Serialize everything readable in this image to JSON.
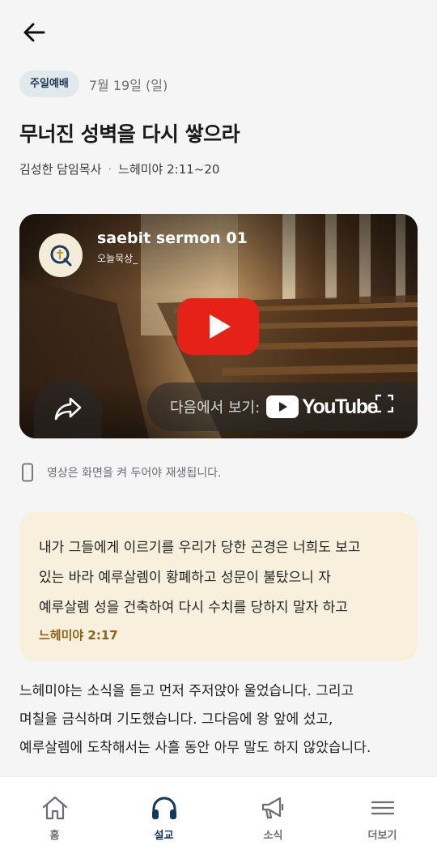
{
  "header": {
    "back_icon": "arrow-left-icon"
  },
  "sermon": {
    "category": "주일예배",
    "date": "7월 19일 (일)",
    "title": "무너진 성벽을 다시 쌓으라",
    "preacher": "김성한 담임목사",
    "separator": "·",
    "passage": "느헤미야 2:11~20"
  },
  "video": {
    "title": "saebit sermon 01",
    "channel": "오늘묵상_",
    "watch_on_label": "다음에서 보기:",
    "youtube_label": "YouTube",
    "icons": [
      "play-icon",
      "share-icon",
      "youtube-logo-icon",
      "fullscreen-icon",
      "channel-logo-icon"
    ]
  },
  "notice": {
    "text": "영상은 화면을 켜 두어야 재생됩니다.",
    "icon": "phone-icon"
  },
  "quote": {
    "lines": [
      "내가 그들에게 이르기를 우리가 당한 곤경은 너희도 보고",
      "있는 바라 예루살렘이 황폐하고 성문이 불탔으니 자",
      "예루살렘 성을 건축하여 다시 수치를 당하지 말자 하고"
    ],
    "reference": "느헤미야 2:17"
  },
  "body": {
    "lines": [
      "느헤미야는 소식을 듣고 먼저 주저앉아 울었습니다. 그리고",
      "며칠을 금식하며 기도했습니다. 그다음에 왕 앞에 섰고,",
      "예루살렘에 도착해서는 사흘 동안 아무 말도 하지 않았습니다."
    ]
  },
  "tabbar": {
    "tabs": [
      {
        "label": "홈",
        "icon": "home-icon",
        "active": false
      },
      {
        "label": "설교",
        "icon": "headphones-icon",
        "active": true
      },
      {
        "label": "소식",
        "icon": "megaphone-icon",
        "active": false
      },
      {
        "label": "더보기",
        "icon": "menu-icon",
        "active": false
      }
    ]
  },
  "colors": {
    "accent": "#15385a",
    "badge_bg": "#e2e9ec",
    "quote_bg": "#f8f0dd",
    "quote_ref": "#8a6416",
    "youtube_red": "#e62117"
  }
}
